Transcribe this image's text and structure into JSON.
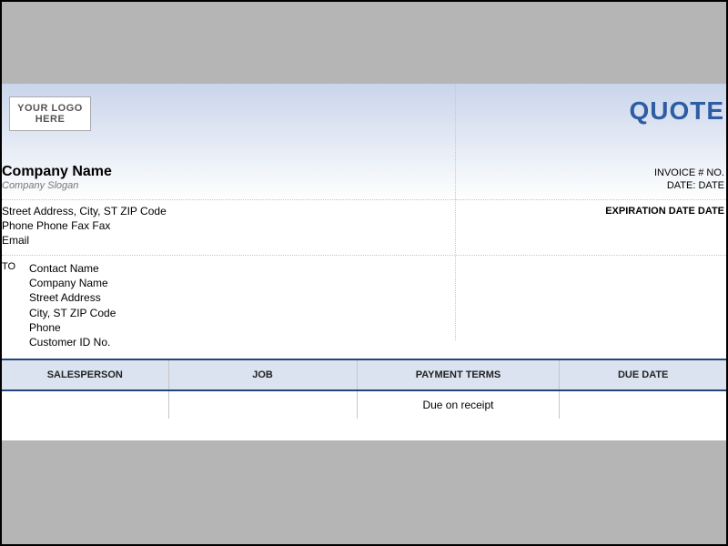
{
  "logo_placeholder": "YOUR LOGO HERE",
  "title": "QUOTE",
  "company": {
    "name": "Company Name",
    "slogan": "Company Slogan",
    "address_line": "Street Address, City, ST ZIP Code",
    "phone_fax_line": "Phone Phone Fax Fax",
    "email_line": "Email"
  },
  "meta": {
    "invoice_no": "INVOICE # NO.",
    "date": "DATE: DATE",
    "expiration": "EXPIRATION DATE DATE"
  },
  "bill_to": {
    "label": "TO",
    "contact": "Contact Name",
    "company": "Company Name",
    "street": "Street Address",
    "city": "City, ST ZIP Code",
    "phone": "Phone",
    "customer_id": "Customer ID No."
  },
  "table": {
    "headers": {
      "salesperson": "SALESPERSON",
      "job": "JOB",
      "payment_terms": "PAYMENT TERMS",
      "due_date": "DUE DATE"
    },
    "row": {
      "salesperson": "",
      "job": "",
      "payment_terms": "Due on receipt",
      "due_date": ""
    }
  }
}
